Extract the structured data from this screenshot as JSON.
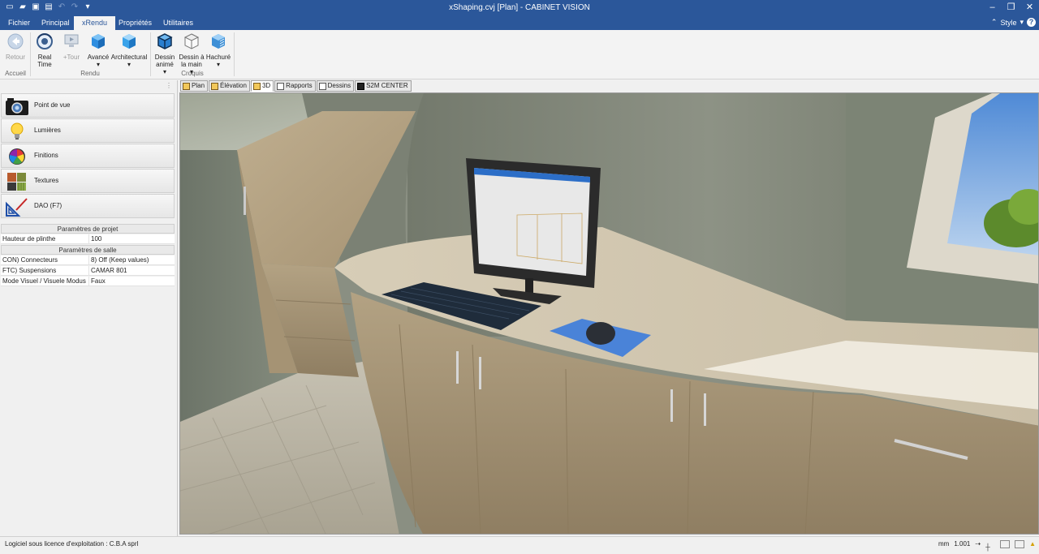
{
  "window": {
    "title": "xShaping.cvj [Plan] - CABINET VISION",
    "minimize_icon": "minimize-icon",
    "restore_icon": "restore-icon",
    "close_icon": "close-icon"
  },
  "ribbon_tabs": [
    "Fichier",
    "Principal",
    "xRendu",
    "Propriétés",
    "Utilitaires"
  ],
  "active_tab": "xRendu",
  "style_menu": {
    "label": "Style",
    "help": "?"
  },
  "ribbon": {
    "groups": [
      {
        "label": "Accueil",
        "buttons": [
          {
            "label": "Retour",
            "icon": "back-arrow-icon",
            "enabled": false
          }
        ]
      },
      {
        "label": "Rendu",
        "buttons": [
          {
            "label": "Real\nTime",
            "icon": "realtime-icon",
            "enabled": true
          },
          {
            "label": "+Tour",
            "icon": "tour-icon",
            "enabled": false
          },
          {
            "label": "Avancé",
            "icon": "cube-advanced-icon",
            "enabled": true
          },
          {
            "label": "Architectural",
            "icon": "cube-architectural-icon",
            "enabled": true
          }
        ]
      },
      {
        "label": "Croquis",
        "buttons": [
          {
            "label": "Dessin\nanimé",
            "icon": "cube-cartoon-icon",
            "enabled": true
          },
          {
            "label": "Dessin à\nla main",
            "icon": "cube-hand-icon",
            "enabled": true
          },
          {
            "label": "Hachuré",
            "icon": "cube-hatched-icon",
            "enabled": true
          }
        ]
      }
    ]
  },
  "left_panel": {
    "nav": [
      {
        "label": "Point de vue",
        "icon": "camera-icon"
      },
      {
        "label": "Lumières",
        "icon": "lightbulb-icon"
      },
      {
        "label": "Finitions",
        "icon": "color-wheel-icon"
      },
      {
        "label": "Textures",
        "icon": "textures-icon"
      },
      {
        "label": "DAO (F7)",
        "icon": "set-square-icon"
      }
    ],
    "project_params": {
      "title": "Paramètres de projet",
      "rows": [
        {
          "key": "Hauteur de plinthe",
          "value": "100"
        }
      ]
    },
    "room_params": {
      "title": "Paramètres de salle",
      "rows": [
        {
          "key": "CON) Connecteurs",
          "value": "8) Off (Keep values)"
        },
        {
          "key": "FTC) Suspensions",
          "value": "CAMAR 801"
        },
        {
          "key": "Mode Visuel / Visuele Modus",
          "value": "Faux"
        }
      ]
    }
  },
  "doc_tabs": [
    "Plan",
    "Élévation",
    "3D",
    "Rapports",
    "Dessins",
    "S2M CENTER"
  ],
  "active_doc_tab": "3D",
  "status": {
    "license": "Logiciel sous licence d'exploitation : C.B.A sprl",
    "unit": "mm",
    "scale": "1.001"
  }
}
